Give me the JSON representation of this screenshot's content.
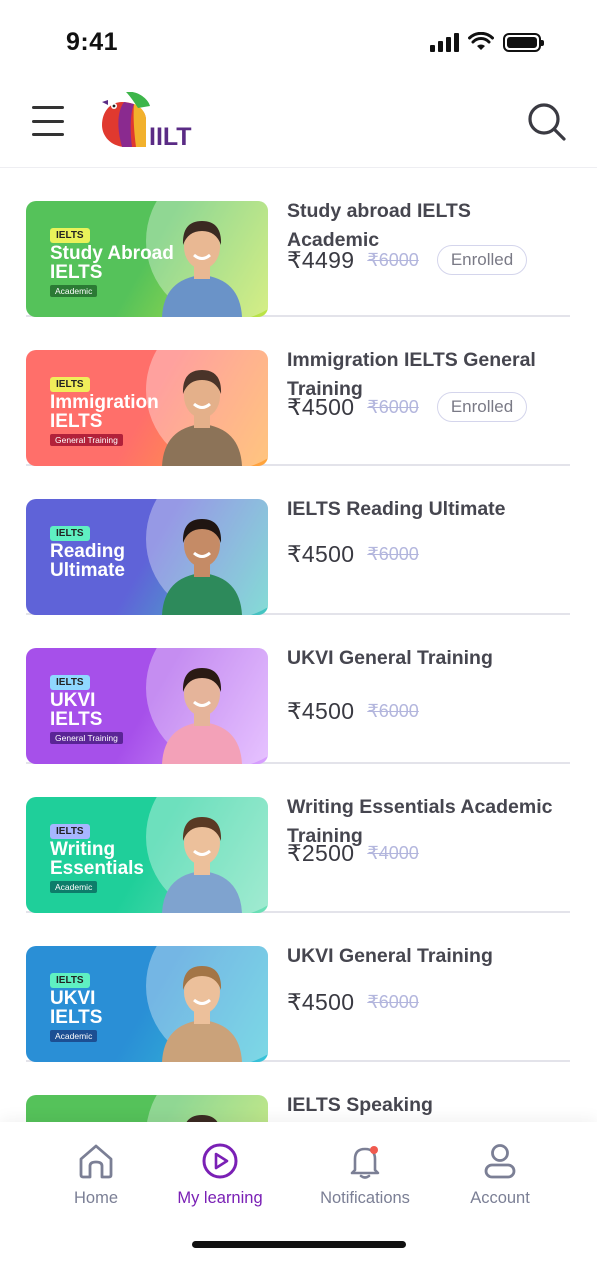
{
  "status_bar": {
    "time": "9:41"
  },
  "header": {
    "logo_text": "IILT"
  },
  "courses": [
    {
      "title": "Study abroad IELTS Academic",
      "price": "₹4499",
      "old_price": "₹6000",
      "badge": "Enrolled",
      "thumb": {
        "tag": "IELTS",
        "line1": "Study Abroad",
        "line2": "IELTS",
        "sub": "Academic",
        "bg": "#55c25a",
        "accent": "#bfe545",
        "tag_color": "#e9f25a",
        "sub_color": "#2b7a34"
      }
    },
    {
      "title": "Immigration IELTS General Training",
      "price": "₹4500",
      "old_price": "₹6000",
      "badge": "Enrolled",
      "thumb": {
        "tag": "IELTS",
        "line1": "Immigration",
        "line2": "IELTS",
        "sub": "General Training",
        "bg": "#ff6f6a",
        "accent": "#ffa63a",
        "tag_color": "#f1ee5a",
        "sub_color": "#b2213a"
      }
    },
    {
      "title": "IELTS Reading Ultimate",
      "price": "₹4500",
      "old_price": "₹6000",
      "badge": "",
      "thumb": {
        "tag": "IELTS",
        "line1": "Reading",
        "line2": "Ultimate",
        "sub": "",
        "bg": "#5f63d8",
        "accent": "#43c9c0",
        "tag_color": "#5ff0c2",
        "sub_color": "#3b3ba8"
      }
    },
    {
      "title": "UKVI General Training",
      "price": "₹4500",
      "old_price": "₹6000",
      "badge": "",
      "thumb": {
        "tag": "IELTS",
        "line1": "UKVI",
        "line2": "IELTS",
        "sub": "General Training",
        "bg": "#a650ea",
        "accent": "#d9a2ff",
        "tag_color": "#8fd8ff",
        "sub_color": "#5a2496"
      }
    },
    {
      "title": "Writing Essentials Academic Training",
      "price": "₹2500",
      "old_price": "₹4000",
      "badge": "",
      "thumb": {
        "tag": "IELTS",
        "line1": "Writing",
        "line2": "Essentials",
        "sub": "Academic",
        "bg": "#1fcf9a",
        "accent": "#6fe0b8",
        "tag_color": "#a7b6ff",
        "sub_color": "#0d7d6a"
      }
    },
    {
      "title": "UKVI General Training",
      "price": "₹4500",
      "old_price": "₹6000",
      "badge": "",
      "thumb": {
        "tag": "IELTS",
        "line1": "UKVI",
        "line2": "IELTS",
        "sub": "Academic",
        "bg": "#2a8fd6",
        "accent": "#37c4d8",
        "tag_color": "#5ff0c2",
        "sub_color": "#1c4f93"
      }
    },
    {
      "title": "IELTS Speaking",
      "price": "",
      "old_price": "",
      "badge": "",
      "thumb": {
        "tag": "",
        "line1": "",
        "line2": "",
        "sub": "",
        "bg": "#55c25a",
        "accent": "#bfe545",
        "tag_color": "#e9f25a",
        "sub_color": "#2b7a34"
      }
    }
  ],
  "nav": {
    "items": [
      {
        "label": "Home",
        "icon": "home-icon"
      },
      {
        "label": "My learning",
        "icon": "play-circle-icon"
      },
      {
        "label": "Notifications",
        "icon": "bell-icon"
      },
      {
        "label": "Account",
        "icon": "user-icon"
      }
    ],
    "active_index": 1,
    "active_color": "#7a20b5",
    "inactive_color": "#7b7f95"
  }
}
